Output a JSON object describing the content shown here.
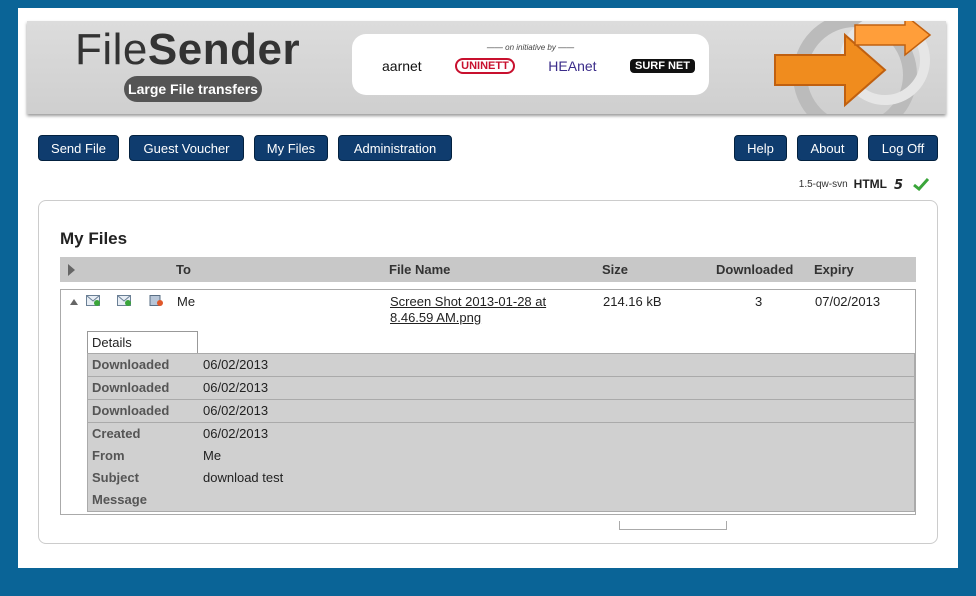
{
  "header": {
    "brand_light": "File",
    "brand_bold": "Sender",
    "tagline": "Large File transfers",
    "initiative": "—— on initiative by ——",
    "partners": [
      "aarnet",
      "UNINETT",
      "HEAnet",
      "SURF NET"
    ]
  },
  "nav": {
    "send_file": "Send File",
    "guest_voucher": "Guest Voucher",
    "my_files": "My Files",
    "administration": "Administration",
    "help": "Help",
    "about": "About",
    "log_off": "Log Off"
  },
  "version": {
    "build": "1.5-qw-svn",
    "html5": "HTML"
  },
  "panel": {
    "title": "My Files",
    "columns": {
      "to": "To",
      "file_name": "File Name",
      "size": "Size",
      "downloaded": "Downloaded",
      "expiry": "Expiry"
    }
  },
  "file": {
    "to": "Me",
    "name_line1": "Screen Shot 2013-01-28 at",
    "name_line2": "8.46.59 AM.png",
    "size": "214.16 kB",
    "downloaded": "3",
    "expiry": "07/02/2013"
  },
  "details": {
    "tab": "Details",
    "downloads": [
      {
        "label": "Downloaded",
        "value": "06/02/2013"
      },
      {
        "label": "Downloaded",
        "value": "06/02/2013"
      },
      {
        "label": "Downloaded",
        "value": "06/02/2013"
      }
    ],
    "info": [
      {
        "label": "Created",
        "value": "06/02/2013"
      },
      {
        "label": "From",
        "value": "Me"
      },
      {
        "label": "Subject",
        "value": "download test"
      },
      {
        "label": "Message",
        "value": ""
      }
    ]
  },
  "colors": {
    "background": "#0a6497",
    "button": "#0f3c6e",
    "link": "#4b1b87",
    "orange_arrow": "#f08c1e"
  }
}
